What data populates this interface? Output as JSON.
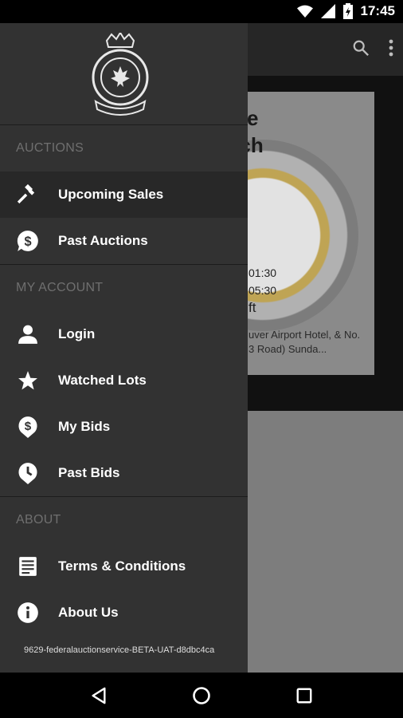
{
  "status_bar": {
    "time": "17:45"
  },
  "background": {
    "title": "T - Fine\ns Watch\nion",
    "times": [
      "01:30",
      "05:30"
    ],
    "size_fragment": "ft",
    "location": "uver Airport Hotel, & No. 3 Road)  Sunda..."
  },
  "drawer": {
    "sections": [
      {
        "header": "AUCTIONS",
        "items": [
          {
            "label": "Upcoming Sales",
            "icon": "gavel-icon",
            "active": true
          },
          {
            "label": "Past Auctions",
            "icon": "dollar-bubble-icon"
          }
        ]
      },
      {
        "header": "MY ACCOUNT",
        "items": [
          {
            "label": "Login",
            "icon": "person-icon"
          },
          {
            "label": "Watched Lots",
            "icon": "star-icon"
          },
          {
            "label": "My Bids",
            "icon": "dollar-pin-icon"
          },
          {
            "label": "Past Bids",
            "icon": "clock-pin-icon"
          }
        ]
      },
      {
        "header": "ABOUT",
        "items": [
          {
            "label": "Terms & Conditions",
            "icon": "document-icon"
          },
          {
            "label": "About Us",
            "icon": "info-icon"
          }
        ]
      }
    ],
    "version": "9629-federalauctionservice-BETA-UAT-d8dbc4ca"
  },
  "colors": {
    "drawer_bg": "#323232",
    "active_bg": "#282828",
    "section_header": "#6f6f6f"
  }
}
